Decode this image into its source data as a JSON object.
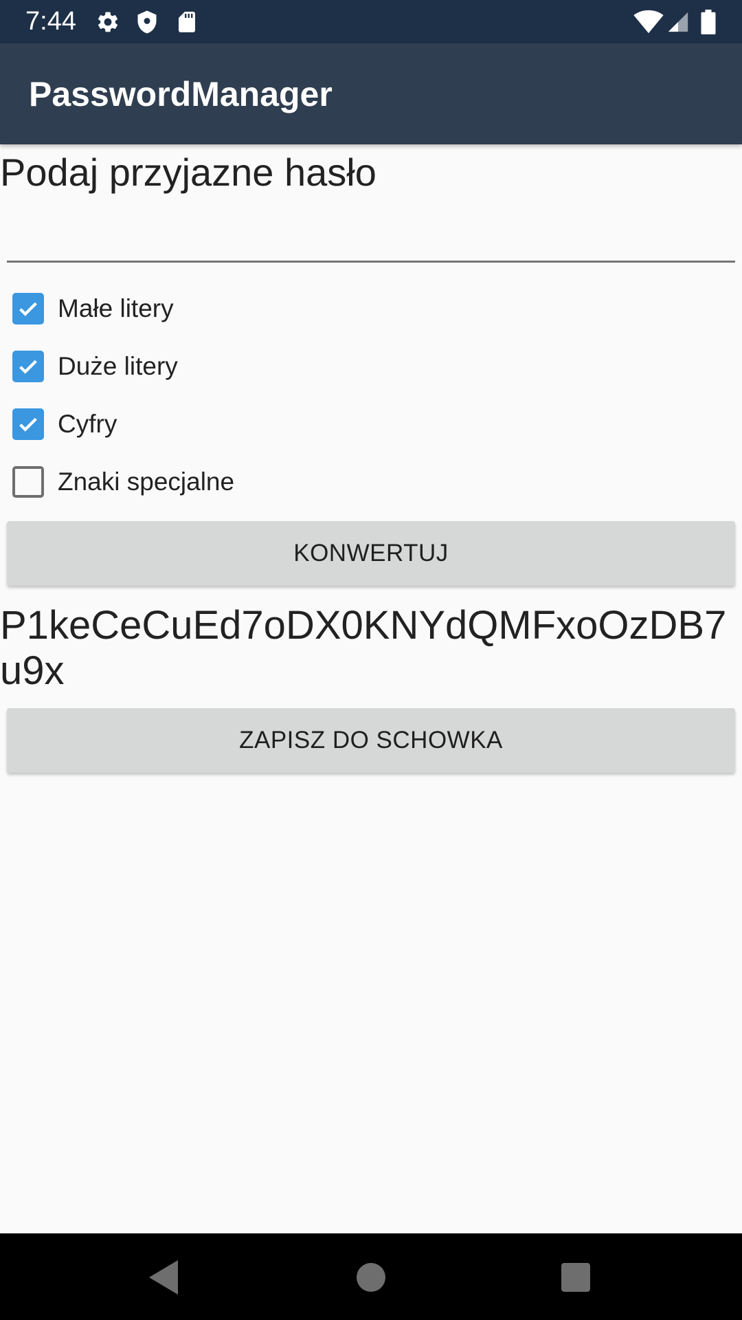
{
  "status_bar": {
    "time": "7:44",
    "icons_left": [
      "gear-icon",
      "shield-icon",
      "sd-card-icon"
    ],
    "icons_right": [
      "wifi-icon",
      "signal-icon",
      "battery-icon"
    ]
  },
  "app_bar": {
    "title": "PasswordManager",
    "color": "#2f3e50"
  },
  "form": {
    "prompt_label": "Podaj przyjazne hasło",
    "input_value": "",
    "input_placeholder": "",
    "options": [
      {
        "label": "Małe litery",
        "checked": true
      },
      {
        "label": "Duże litery",
        "checked": true
      },
      {
        "label": "Cyfry",
        "checked": true
      },
      {
        "label": "Znaki specjalne",
        "checked": false
      }
    ],
    "convert_button": "KONWERTUJ",
    "result": "P1keCeCuEd7oDX0KNYdQMFxoOzDB7u9x",
    "copy_button": "ZAPISZ DO SCHOWKA"
  },
  "colors": {
    "checkbox_accent": "#3a97e0",
    "status_bar": "#1e3048",
    "button": "#d6d7d7"
  },
  "nav_bar": {
    "buttons": [
      "back-icon",
      "home-icon",
      "recents-icon"
    ]
  }
}
